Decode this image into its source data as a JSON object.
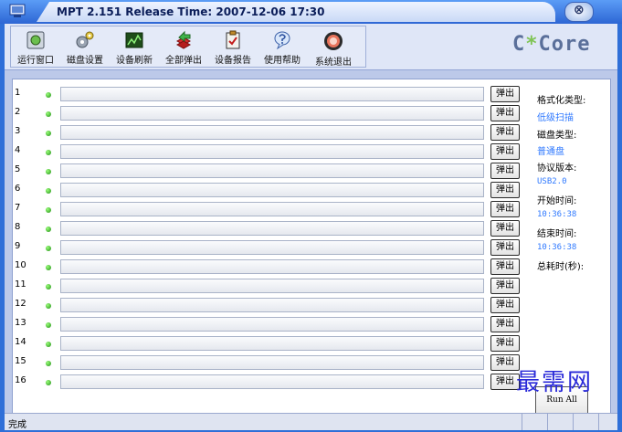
{
  "window": {
    "title": "MPT 2.151 Release Time: 2007-12-06 17:30",
    "close_glyph": "⊗"
  },
  "toolbar": {
    "buttons": [
      {
        "label": "运行窗口",
        "icon": "run-window-icon"
      },
      {
        "label": "磁盘设置",
        "icon": "gears-icon"
      },
      {
        "label": "设备刷新",
        "icon": "refresh-icon"
      },
      {
        "label": "全部弹出",
        "icon": "eject-all-icon"
      },
      {
        "label": "设备报告",
        "icon": "report-icon"
      },
      {
        "label": "使用帮助",
        "icon": "help-icon"
      },
      {
        "label": "系统退出",
        "icon": "exit-icon"
      }
    ],
    "brand_prefix": "C",
    "brand_star": "*",
    "brand_suffix": "Core"
  },
  "ports": [
    {
      "num": "1",
      "eject": "弹出"
    },
    {
      "num": "2",
      "eject": "弹出"
    },
    {
      "num": "3",
      "eject": "弹出"
    },
    {
      "num": "4",
      "eject": "弹出"
    },
    {
      "num": "5",
      "eject": "弹出"
    },
    {
      "num": "6",
      "eject": "弹出"
    },
    {
      "num": "7",
      "eject": "弹出"
    },
    {
      "num": "8",
      "eject": "弹出"
    },
    {
      "num": "9",
      "eject": "弹出"
    },
    {
      "num": "10",
      "eject": "弹出"
    },
    {
      "num": "11",
      "eject": "弹出"
    },
    {
      "num": "12",
      "eject": "弹出"
    },
    {
      "num": "13",
      "eject": "弹出"
    },
    {
      "num": "14",
      "eject": "弹出"
    },
    {
      "num": "15",
      "eject": "弹出"
    },
    {
      "num": "16",
      "eject": "弹出"
    }
  ],
  "info": {
    "format_type_label": "格式化类型:",
    "format_type_value": "低级扫描",
    "disk_type_label": "磁盘类型:",
    "disk_type_value": "普通盘",
    "protocol_label": "协议版本:",
    "protocol_value": "USB2.0",
    "start_label": "开始时间:",
    "start_value": "10:36:38",
    "end_label": "结束时间:",
    "end_value": "10:36:38",
    "elapsed_label": "总耗时(秒):"
  },
  "run_all_label": "Run All",
  "status_text": "完成",
  "watermark": "最需网",
  "colors": {
    "accent": "#2f79ff",
    "led": "#2ea81d"
  }
}
